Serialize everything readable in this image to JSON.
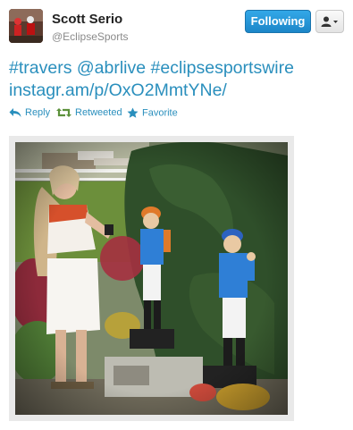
{
  "user": {
    "name": "Scott Serio",
    "handle": "@EclipseSports",
    "follow_label": "Following"
  },
  "tweet": {
    "hashtag1": "#travers",
    "mention": "@abrlive",
    "hashtag2": "#eclipsesportswire",
    "link": "instagr.am/p/OxO2MmtYNe/"
  },
  "actions": {
    "reply": "Reply",
    "retweeted": "Retweeted",
    "favorite": "Favorite"
  },
  "colors": {
    "link": "#2a8fbd",
    "follow_button": "#1c86c8",
    "retweet_green": "#5c913b"
  },
  "icons": [
    "reply-icon",
    "retweet-icon",
    "favorite-icon",
    "user-icon",
    "caret-down-icon"
  ]
}
